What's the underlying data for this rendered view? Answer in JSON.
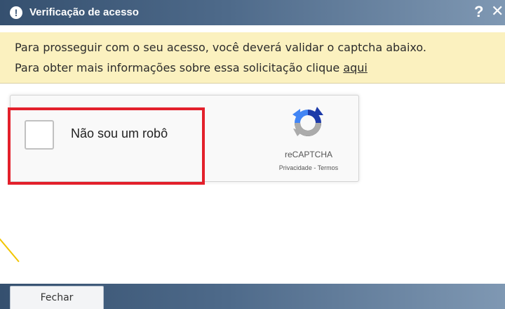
{
  "dialog": {
    "title": "Verificação de acesso",
    "title_icon": "alert-icon",
    "help_label": "?",
    "close_label": "X"
  },
  "notice": {
    "line1": "Para prosseguir com o seu acesso, você deverá validar o captcha abaixo.",
    "line2_prefix": "Para obter mais informações sobre essa solicitação clique ",
    "link_text": "aqui"
  },
  "recaptcha": {
    "checkbox_label": "Não sou um robô",
    "checked": false,
    "brand": "reCAPTCHA",
    "privacy_label": "Privacidade",
    "separator": " - ",
    "terms_label": "Termos",
    "logo_icon": "recaptcha-logo-icon"
  },
  "footer": {
    "close_button_label": "Fechar"
  },
  "colors": {
    "titlebar": "#4e6a8a",
    "notice_bg": "#fbf1bf",
    "highlight": "#e3202b",
    "decoration": "#f2c500"
  }
}
